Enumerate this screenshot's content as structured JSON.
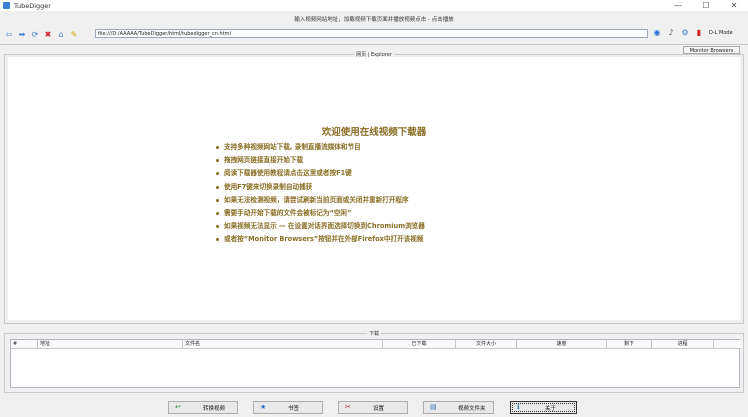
{
  "window": {
    "title": "TubeDigger",
    "minimize": "—",
    "maximize": "☐",
    "close": "✕"
  },
  "hint": "输入视频网站地址，加载视频下载页面并播放视频点击 - 点击播放",
  "address": {
    "value": "file:///D:/AAAAA/TubeDigger/html/tubedigger_cn.html"
  },
  "toolbar": {
    "dl_mode": "D-L Mode",
    "monitor_browsers": "Monitor Browsers"
  },
  "browser_group": {
    "label": "网页 | Explorer"
  },
  "welcome": {
    "title": "欢迎使用在线视频下载器",
    "tips": [
      "支持多种视频网站下载, 录制直播流媒体和节目",
      "拖拽网页链接直接开始下载",
      "阅读下载器使用教程请点击这里或者按F1键",
      "使用F7键来切换录制自动捕获",
      "如果无法检测视频，请尝试刷新当前页面或关闭并重新打开程序",
      "需要手动开始下载的文件会被标记为“空闲”",
      "如果视频无法显示 — 在设置对话界面选择切换到Chromium浏览器",
      "或者按“Monitor Browsers”按钮并在外部Firefox中打开该视频"
    ]
  },
  "downloads": {
    "label": "下载",
    "columns": [
      "#",
      "地址",
      "文件名",
      "已下载",
      "文件大小",
      "速度",
      "剩下",
      "进程"
    ]
  },
  "buttons": {
    "convert": "转换视频",
    "bookmarks": "书签",
    "settings": "设置",
    "video_folder": "视频文件夹",
    "about": "关于"
  },
  "colors": {
    "tip_text": "#8a6d23",
    "accent": "#3a7fd5"
  }
}
